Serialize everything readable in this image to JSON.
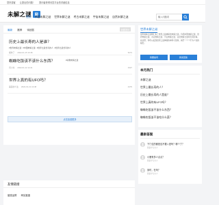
{
  "topbar": {
    "items": [
      "您好游客",
      "让提出的问题！",
      "提问者获得问答平台的详细信息"
    ]
  },
  "header": {
    "logo_text": "未解之谜",
    "logo_badge": "网",
    "nav": [
      "首页",
      "中国未解之谜",
      "世界未解之谜",
      "考古未解之谜",
      "宇宙未解之谜",
      "自然未解之谜"
    ],
    "search_placeholder": "输入问题词"
  },
  "main": {
    "tabs": [
      "最新",
      "推荐",
      "待回答"
    ],
    "ask_label": "我要提问",
    "questions": [
      {
        "title": "历史上最长寿的人是谁？",
        "tags": [
          "#世界未解之谜",
          "#中国未解之谜",
          "#世界之最长寿的人",
          "#世界之最长寿的人"
        ],
        "author": "懂你了",
        "date": "2022-01-15 10:48",
        "count": "5274"
      },
      {
        "title": "蜘蛛吃饭该不该什么东西？",
        "tags": [
          "#动物未解之谜"
        ],
        "author": "问小书",
        "date": "2022-01-12 14:41",
        "count": "3327"
      },
      {
        "title": "世界上真的有UFO吗？",
        "tags": [],
        "author": "美丽的人生",
        "date": "2022-01-21 13:48",
        "count": "4479"
      }
    ],
    "more_label": "点击加载更多"
  },
  "sidebar": {
    "intro_title": "世界未解之谜",
    "intro_text": "世界未解之谜网汇集了世界上最神秘的未解之谜，包括中国未解之谜、世界未解之谜、考古未解之谜、宇宙未解之谜、自然未解之谜等奇闻异事。在这里，你可以发现世界上最神秘的事件与现象，揭开一个个不为人知的秘密。",
    "btn_ask": "我要提问",
    "btn_answer": "我来回答",
    "hot_title": "本月热门",
    "hot_items": [
      "未解之谜",
      "世界上最长寿的人？",
      "历史上最长寿的人是谁？",
      "世界上真的有UFO吗？",
      "蜘蛛吃饭该不该什么东西？",
      "蜘蛛吃饭该不该吃什么菜？"
    ],
    "answers_title": "最新答案",
    "answers": [
      {
        "q": "下门位的都是应不要入是吗？哪个了？",
        "sub": "答案学习大人"
      },
      {
        "q": "小鹿有多少点点？",
        "sub": "答案学习大人"
      },
      {
        "q": "到时，在吗？",
        "sub": "答案学习大人"
      }
    ]
  },
  "links": {
    "title": "友情链接",
    "items": [
      "星座运势",
      "网站星盘"
    ]
  },
  "colors": {
    "accent": "#2a80d8"
  }
}
